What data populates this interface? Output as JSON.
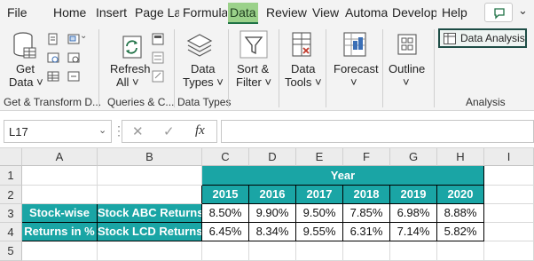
{
  "menu": {
    "tabs": [
      "File",
      "Home",
      "Insert",
      "Page La",
      "Formula",
      "Data",
      "Review",
      "View",
      "Automa",
      "Develop",
      "Help"
    ],
    "active_tab": "Data"
  },
  "ribbon": {
    "get_data": {
      "line1": "Get",
      "line2": "Data ˅"
    },
    "refresh_all": {
      "line1": "Refresh",
      "line2": "All ˅"
    },
    "data_types": {
      "line1": "Data",
      "line2": "Types ˅"
    },
    "sort_filter": {
      "line1": "Sort &",
      "line2": "Filter ˅"
    },
    "data_tools": {
      "line1": "Data",
      "line2": "Tools ˅"
    },
    "forecast": {
      "line1": "Forecast",
      "line2": "˅"
    },
    "outline": {
      "line1": "Outline",
      "line2": "˅"
    },
    "data_analysis": "Data Analysis",
    "groups": [
      "Get & Transform D...",
      "Queries & C...",
      "Data Types",
      "Analysis"
    ]
  },
  "formula_bar": {
    "name_box": "L17",
    "fx": "fx",
    "cancel": "✕",
    "enter": "✓",
    "formula": ""
  },
  "sheet": {
    "columns": [
      "A",
      "B",
      "C",
      "D",
      "E",
      "F",
      "G",
      "H",
      "I"
    ],
    "rows": [
      "1",
      "2",
      "3",
      "4",
      "5"
    ],
    "year_header": "Year",
    "years": [
      "2015",
      "2016",
      "2017",
      "2018",
      "2019",
      "2020"
    ],
    "row_label_a3": "Stock-wise",
    "row_label_a4": "Returns in %",
    "stocks": [
      {
        "name": "Stock ABC Returns",
        "values": [
          "8.50%",
          "9.90%",
          "9.50%",
          "7.85%",
          "6.98%",
          "8.88%"
        ]
      },
      {
        "name": "Stock LCD Returns",
        "values": [
          "6.45%",
          "8.34%",
          "9.55%",
          "6.31%",
          "7.14%",
          "5.82%"
        ]
      }
    ]
  },
  "colors": {
    "teal_header": "#1aa5a5",
    "active_tab": "#9bd18a",
    "excel_green": "#1e7145",
    "data_analysis_border": "#1e4d46"
  }
}
